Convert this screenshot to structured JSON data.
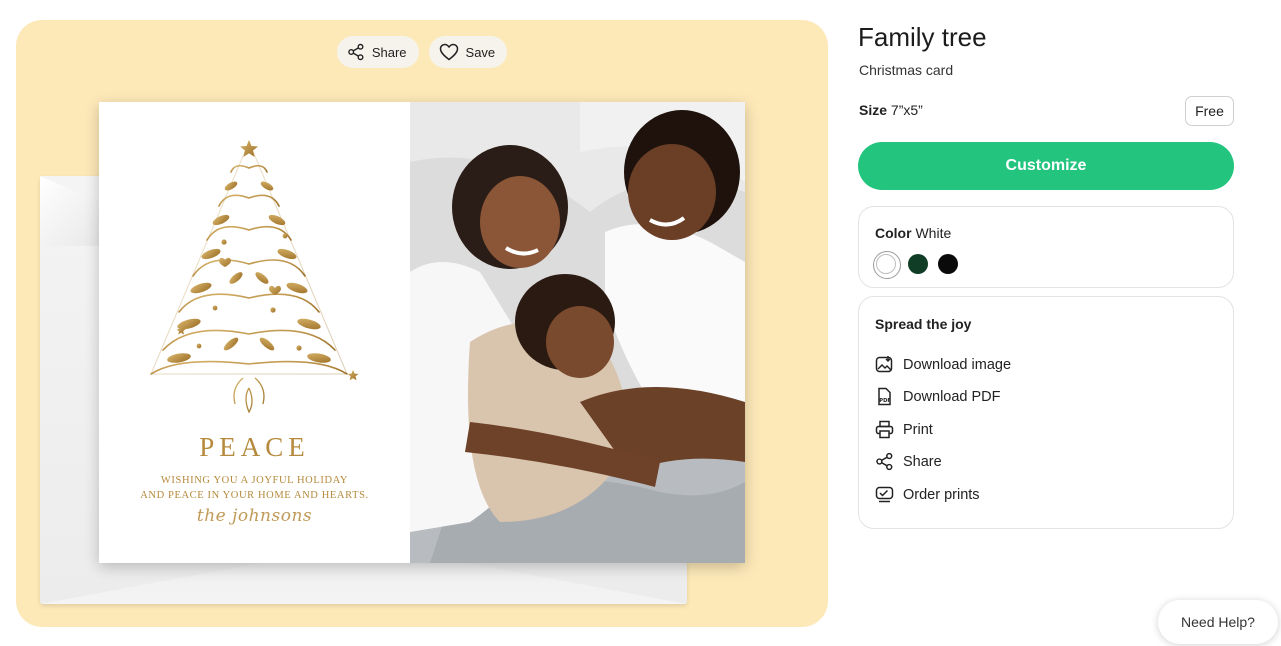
{
  "preview": {
    "share_label": "Share",
    "save_label": "Save",
    "card": {
      "headline": "PEACE",
      "message_line1": "WISHING YOU A JOYFUL HOLIDAY",
      "message_line2": "AND PEACE IN YOUR HOME AND HEARTS.",
      "signature": "the johnsons",
      "photo_icon": "family-photo"
    }
  },
  "product": {
    "title": "Family tree",
    "subtitle": "Christmas card",
    "size_label": "Size",
    "size_value": "7”x5”",
    "price": "Free",
    "customize_label": "Customize"
  },
  "color": {
    "label": "Color",
    "selected": "White",
    "swatches": [
      {
        "name": "White",
        "hex": "#ffffff"
      },
      {
        "name": "Dark green",
        "hex": "#0f3d26"
      },
      {
        "name": "Black",
        "hex": "#0a0a0a"
      }
    ]
  },
  "share": {
    "title": "Spread the joy",
    "items": [
      {
        "label": "Download image",
        "icon": "download-image-icon"
      },
      {
        "label": "Download PDF",
        "icon": "pdf-icon"
      },
      {
        "label": "Print",
        "icon": "printer-icon"
      },
      {
        "label": "Share",
        "icon": "share-icon"
      },
      {
        "label": "Order prints",
        "icon": "order-prints-icon"
      }
    ]
  },
  "help": {
    "label": "Need Help?"
  },
  "colors": {
    "accent": "#22c47e",
    "panel": "#fde9b8",
    "gold": "#b58a3c"
  }
}
